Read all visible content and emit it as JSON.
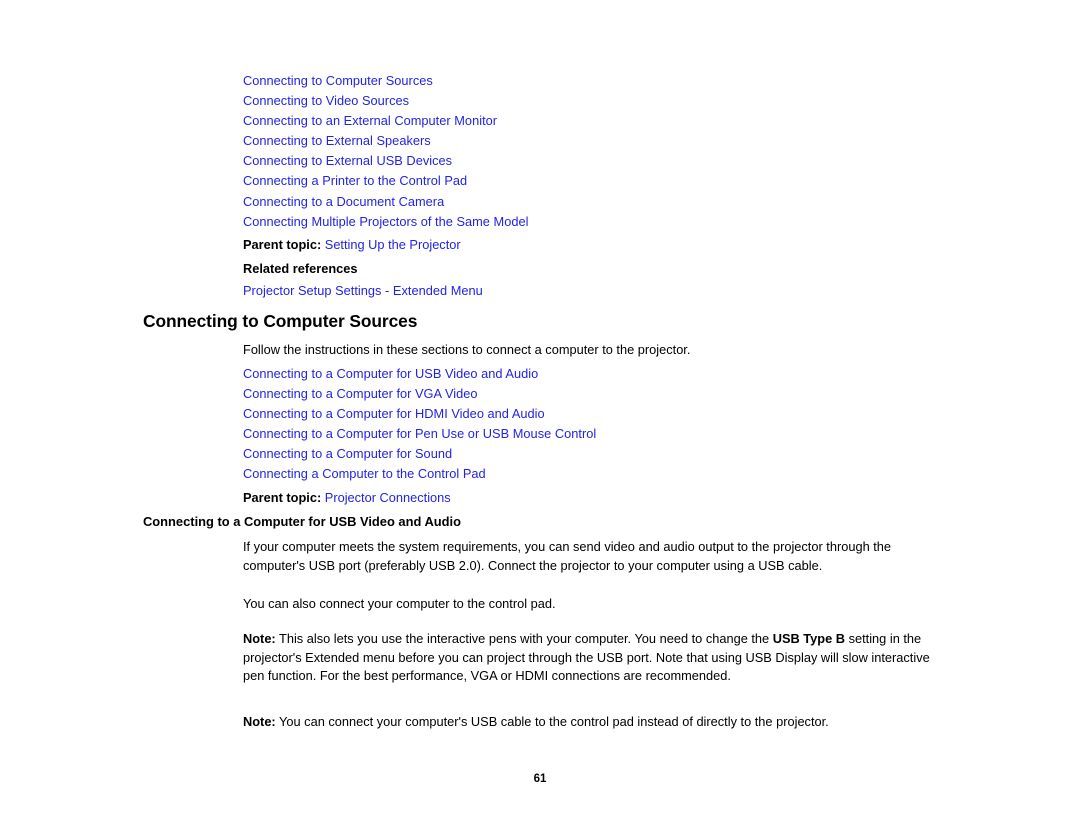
{
  "page": {
    "number": "61",
    "link_color": "#2323e6",
    "text_color": "#000000",
    "background": "#ffffff"
  },
  "top_links": [
    "Connecting to Computer Sources",
    "Connecting to Video Sources",
    "Connecting to an External Computer Monitor",
    "Connecting to External Speakers",
    "Connecting to External USB Devices",
    "Connecting a Printer to the Control Pad",
    "Connecting to a Document Camera",
    "Connecting Multiple Projectors of the Same Model"
  ],
  "top_parent_topic": {
    "label": "Parent topic:",
    "value": "Setting Up the Projector"
  },
  "related_references": {
    "label": "Related references",
    "link": "Projector Setup Settings - Extended Menu"
  },
  "heading": "Connecting to Computer Sources",
  "intro_paragraph": "Follow the instructions in these sections to connect a computer to the projector.",
  "section_links": [
    "Connecting to a Computer for USB Video and Audio",
    "Connecting to a Computer for VGA Video",
    "Connecting to a Computer for HDMI Video and Audio",
    "Connecting to a Computer for Pen Use or USB Mouse Control",
    "Connecting to a Computer for Sound",
    "Connecting a Computer to the Control Pad"
  ],
  "section_parent_topic": {
    "label": "Parent topic:",
    "value": "Projector Connections"
  },
  "subheading": "Connecting to a Computer for USB Video and Audio",
  "paragraph_1": "If your computer meets the system requirements, you can send video and audio output to the projector through the computer's USB port (preferably USB 2.0). Connect the projector to your computer using a USB cable.",
  "paragraph_2": "You can also connect your computer to the control pad.",
  "note_1": {
    "label": "Note:",
    "text_part_1": " This also lets you use the interactive pens with your computer. You need to change the ",
    "bold_1": "USB Type B",
    "text_part_2": " setting in the projector's Extended menu before you can project through the USB port. Note that using USB Display will slow interactive pen function. For the best performance, VGA or HDMI connections are recommended."
  },
  "note_2": {
    "label": "Note:",
    "text": " You can connect your computer's USB cable to the control pad instead of directly to the projector."
  }
}
